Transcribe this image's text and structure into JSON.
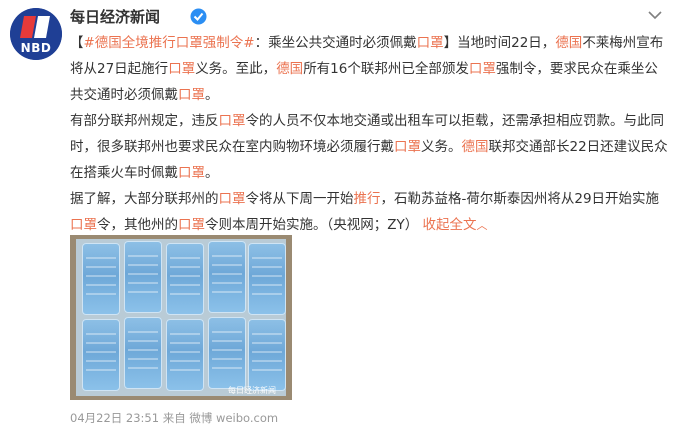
{
  "author": {
    "name": "每日经济新闻",
    "avatar_text": "NBD",
    "verified": true
  },
  "post": {
    "paragraph1": {
      "open": "【",
      "hashtag": "#德国全境推行口罩强制令#",
      "rest1": "：乘坐公共交通时必须佩戴",
      "kw_mask": "口罩",
      "close": "】",
      "rest2": "当地时间22日，",
      "kw_de1": "德国",
      "rest3": "不莱梅州宣布将从27日起施行",
      "kw_mask2": "口罩",
      "rest4": "义务。至此，",
      "kw_de2": "德国",
      "rest5": "所有16个联邦州已全部颁发",
      "kw_mask3": "口罩",
      "rest6": "强制令，要求民众在乘坐公共交通时必须佩戴",
      "kw_mask4": "口罩",
      "end": "。"
    },
    "paragraph2": {
      "rest1": "有部分联邦州规定，违反",
      "kw_mask": "口罩",
      "rest2": "令的人员不仅本地交通或出租车可以拒载，还需承担相应罚款。与此同时，很多联邦州也要求民众在室内购物环境必须履行戴",
      "kw_mask2": "口罩",
      "rest3": "义务。",
      "kw_de": "德国",
      "rest4": "联邦交通部长22日还建议民众在搭乘火车时佩戴",
      "kw_mask3": "口罩",
      "end": "。"
    },
    "paragraph3": {
      "rest1": "据了解，大部分联邦州的",
      "kw_mask": "口罩",
      "rest2": "令将从下周一开始",
      "kw_push": "推行",
      "rest3": "，石勒苏益格-荷尔斯泰因州将从29日开始实施",
      "kw_mask2": "口罩",
      "rest4": "令，其他州的",
      "kw_mask3": "口罩",
      "rest5": "令则本周开始实施。（央视网；ZY）",
      "collapse_label": "收起全文",
      "collapse_arrow": "︿"
    }
  },
  "image": {
    "watermark": "每日经济新闻",
    "description_icon": "photo-of-mask-boxes"
  },
  "meta": {
    "timestamp": "04月22日 23:51",
    "source_prefix": "来自",
    "source": "微博 weibo.com"
  },
  "colors": {
    "accent": "#eb7350",
    "text": "#333333",
    "muted": "#999999",
    "brand": "#1f3f95"
  }
}
